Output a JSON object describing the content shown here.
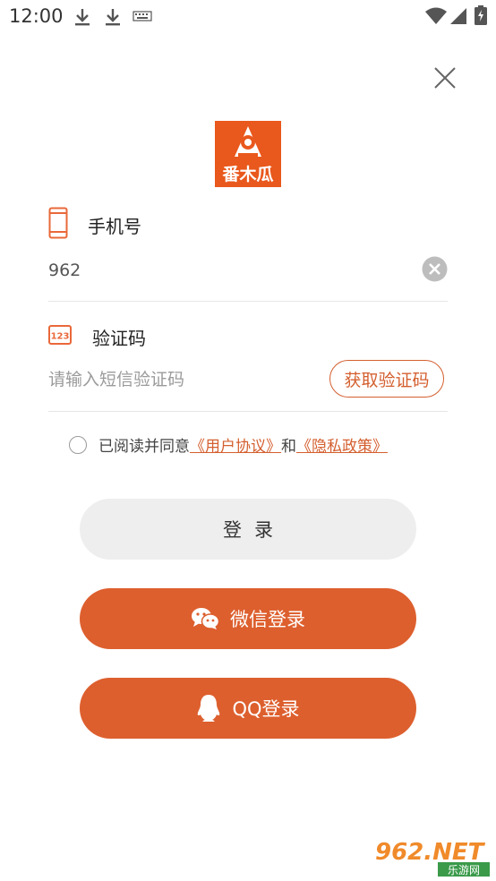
{
  "status_bar": {
    "time": "12:00"
  },
  "logo": {
    "text": "番木瓜"
  },
  "phone": {
    "label": "手机号",
    "value": "962"
  },
  "code": {
    "label": "验证码",
    "placeholder": "请输入短信验证码",
    "get_code_label": "获取验证码"
  },
  "agreement": {
    "prefix": "已阅读并同意",
    "user_agreement": "《用户协议》",
    "and": "和",
    "privacy_policy": "《隐私政策》"
  },
  "buttons": {
    "login": "登录",
    "wechat": "微信登录",
    "qq": "QQ登录"
  },
  "watermark": {
    "top_text": "962.NET",
    "bottom_text": "乐游网"
  },
  "colors": {
    "accent": "#dd5f2e",
    "link": "#d45f2f",
    "logo_bg": "#e9581c",
    "login_bg": "#eeeeee"
  }
}
